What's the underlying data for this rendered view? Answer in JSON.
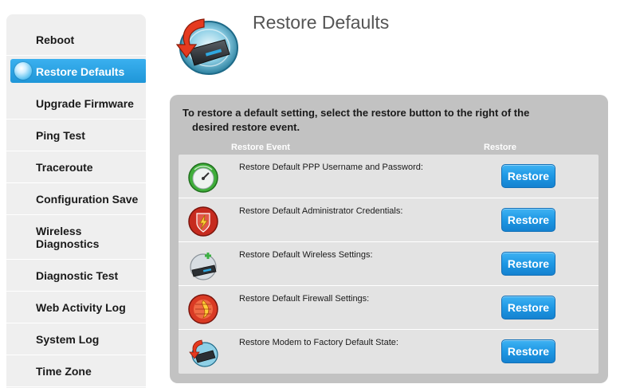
{
  "sidebar": {
    "items": [
      {
        "label": "Reboot"
      },
      {
        "label": "Restore Defaults",
        "active": true
      },
      {
        "label": "Upgrade Firmware"
      },
      {
        "label": "Ping Test"
      },
      {
        "label": "Traceroute"
      },
      {
        "label": "Configuration Save"
      },
      {
        "label_line1": "Wireless",
        "label_line2": "Diagnostics"
      },
      {
        "label": "Diagnostic Test"
      },
      {
        "label": "Web Activity Log"
      },
      {
        "label": "System Log"
      },
      {
        "label": "Time Zone"
      }
    ]
  },
  "header": {
    "title": "Restore Defaults",
    "icon": "restore-drive-icon"
  },
  "panel": {
    "intro_line1": "To restore a default setting, select the restore button to the right of the",
    "intro_line2": "desired restore event.",
    "col_event": "Restore Event",
    "col_restore": "Restore",
    "rows": [
      {
        "label": "Restore Default PPP Username and Password:",
        "button": "Restore",
        "icon": "gauge-icon"
      },
      {
        "label": "Restore Default Administrator Credentials:",
        "button": "Restore",
        "icon": "shield-lightning-icon"
      },
      {
        "label": "Restore Default Wireless Settings:",
        "button": "Restore",
        "icon": "wireless-drive-icon"
      },
      {
        "label": "Restore Default Firewall Settings:",
        "button": "Restore",
        "icon": "firewall-icon"
      },
      {
        "label": "Restore Modem to Factory Default State:",
        "button": "Restore",
        "icon": "restore-drive-icon"
      }
    ]
  },
  "colors": {
    "accent": "#1f96d8",
    "button": "#1e98e4",
    "sidebar_bg": "#efefef",
    "panel_bg": "#c2c2c2"
  }
}
